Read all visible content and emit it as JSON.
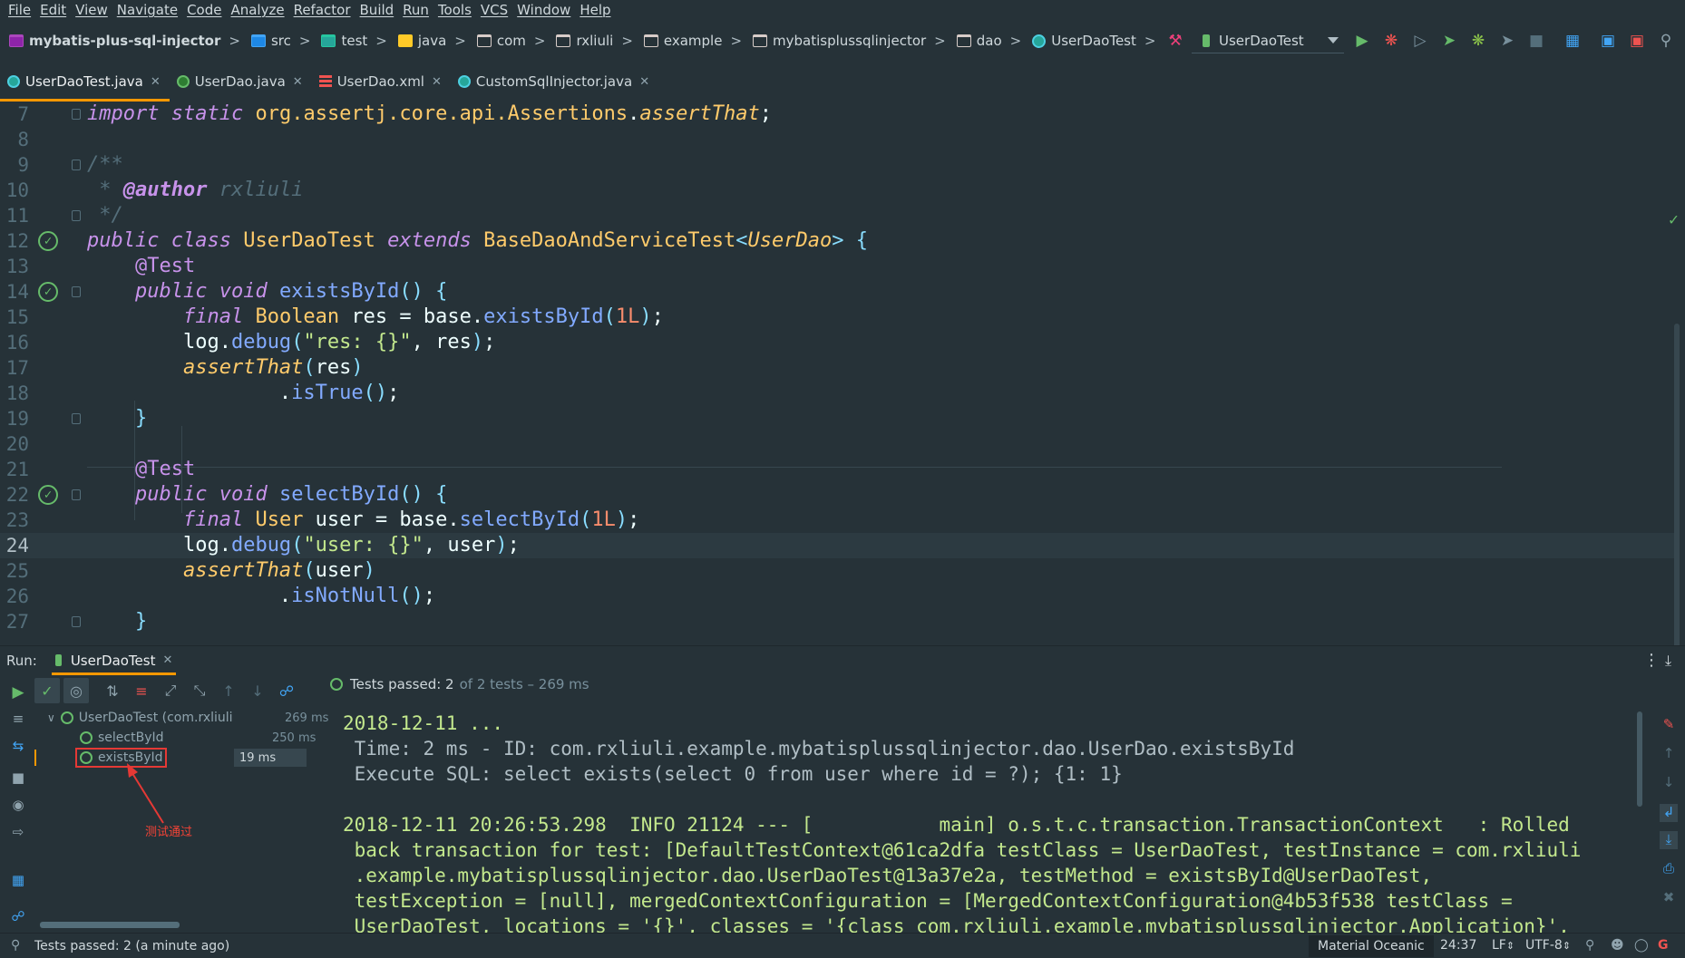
{
  "menu": [
    "File",
    "Edit",
    "View",
    "Navigate",
    "Code",
    "Analyze",
    "Refactor",
    "Build",
    "Run",
    "Tools",
    "VCS",
    "Window",
    "Help"
  ],
  "breadcrumb": [
    "mybatis-plus-sql-injector",
    "src",
    "test",
    "java",
    "com",
    "rxliuli",
    "example",
    "mybatisplussqlinjector",
    "dao",
    "UserDaoTest"
  ],
  "run_config": "UserDaoTest",
  "tabs": [
    "UserDaoTest.java",
    "UserDao.java",
    "UserDao.xml",
    "CustomSqlInjector.java"
  ],
  "editor": {
    "line_numbers": [
      "7",
      "8",
      "9",
      "10",
      "11",
      "12",
      "13",
      "14",
      "15",
      "16",
      "17",
      "18",
      "19",
      "20",
      "21",
      "22",
      "23",
      "24",
      "25",
      "26",
      "27"
    ]
  },
  "run_panel": {
    "label": "Run:",
    "tab": "UserDaoTest",
    "pass_summary": "Tests passed: 2",
    "pass_detail": "of 2 tests – 269 ms",
    "tree": [
      {
        "name": "UserDaoTest (com.rxliuli.examp",
        "ms": "269 ms"
      },
      {
        "name": "selectById",
        "ms": "250 ms"
      },
      {
        "name": "existsById",
        "ms": "19 ms"
      }
    ],
    "annotation": "测试通过",
    "console": [
      "2018-12-11 ...",
      " Time: 2 ms - ID: com.rxliuli.example.mybatisplussqlinjector.dao.UserDao.existsById",
      " Execute SQL: select exists(select 0 from user where id = ?); {1: 1}",
      "",
      "2018-12-11 20:26:53.298  INFO 21124 --- [           main] o.s.t.c.transaction.TransactionContext   : Rolled",
      " back transaction for test: [DefaultTestContext@61ca2dfa testClass = UserDaoTest, testInstance = com.rxliuli",
      " .example.mybatisplussqlinjector.dao.UserDaoTest@13a37e2a, testMethod = existsById@UserDaoTest,",
      " testException = [null], mergedContextConfiguration = [MergedContextConfiguration@4b53f538 testClass =",
      " UserDaoTest, locations = '{}', classes = '{class com.rxliuli.example.mybatisplussqlinjector.Application}',"
    ]
  },
  "status": {
    "message": "Tests passed: 2 (a minute ago)",
    "theme": "Material Oceanic",
    "position": "24:37",
    "line_sep": "LF",
    "encoding": "UTF-8"
  },
  "colors": {
    "background": "#263238",
    "accent": "#ff9800",
    "pass": "#66bb6a",
    "highlight_box": "#e53935"
  }
}
